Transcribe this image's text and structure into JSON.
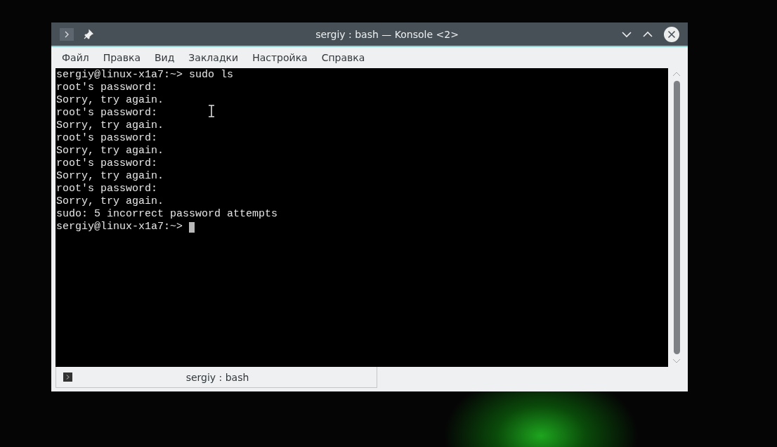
{
  "window": {
    "title": "sergiy : bash — Konsole <2>"
  },
  "menu": [
    "Файл",
    "Правка",
    "Вид",
    "Закладки",
    "Настройка",
    "Справка"
  ],
  "terminal": {
    "lines": [
      "sergiy@linux-x1a7:~> sudo ls",
      "root's password:",
      "Sorry, try again.",
      "root's password:",
      "Sorry, try again.",
      "root's password:",
      "Sorry, try again.",
      "root's password:",
      "Sorry, try again.",
      "root's password:",
      "Sorry, try again.",
      "sudo: 5 incorrect password attempts",
      "sergiy@linux-x1a7:~> "
    ],
    "cursor": true
  },
  "tabs": [
    {
      "label": "sergiy : bash",
      "selected": true
    }
  ]
}
